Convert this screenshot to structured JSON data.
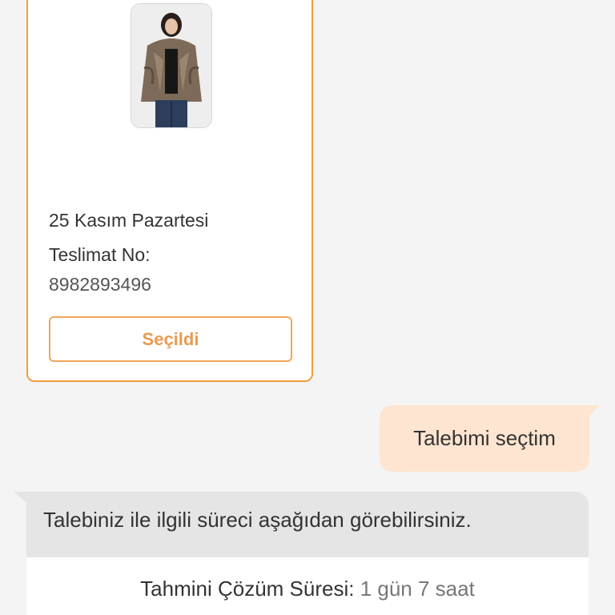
{
  "order_card": {
    "date": "25 Kasım Pazartesi",
    "delivery_label": "Teslimat No:",
    "delivery_number": "8982893496",
    "selected_button_label": "Seçildi",
    "product_image": "product-photo-fur-jacket"
  },
  "user_message": "Talebimi seçtim",
  "bot_message": {
    "text": "Talebiniz ile ilgili süreci aşağıdan görebilirsiniz.",
    "resolution_label": "Tahmini Çözüm Süresi:",
    "resolution_value": "1 gün 7 saat"
  },
  "colors": {
    "accent": "#f29d3e",
    "user_bubble": "#fde5d1",
    "bot_bubble": "#e5e5e5",
    "background": "#f4f4f4"
  }
}
